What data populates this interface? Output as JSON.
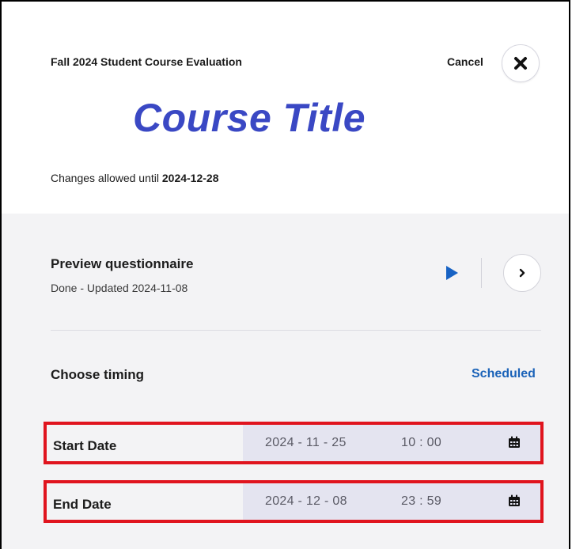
{
  "header": {
    "evaluation_title": "Fall 2024 Student Course Evaluation",
    "cancel_label": "Cancel",
    "close_icon": "close-icon",
    "course_title": "Course Title",
    "changes_prefix": "Changes allowed until",
    "changes_date": "2024-12-28"
  },
  "preview": {
    "title": "Preview questionnaire",
    "status": "Done - Updated 2024-11-08",
    "play_icon": "play-icon",
    "next_icon": "chevron-right-icon"
  },
  "timing": {
    "title": "Choose timing",
    "mode": "Scheduled",
    "start": {
      "label": "Start Date",
      "date": "2024 - 11 - 25",
      "time": "10 : 00",
      "icon": "calendar-icon"
    },
    "end": {
      "label": "End Date",
      "date": "2024 - 12 - 08",
      "time": "23 : 59",
      "icon": "calendar-icon"
    }
  },
  "colors": {
    "course_title": "#3a48c4",
    "accent_blue": "#1762c4",
    "highlight_border": "#e0141e",
    "field_bg": "#e4e4f0",
    "panel_bg": "#f3f3f5"
  }
}
